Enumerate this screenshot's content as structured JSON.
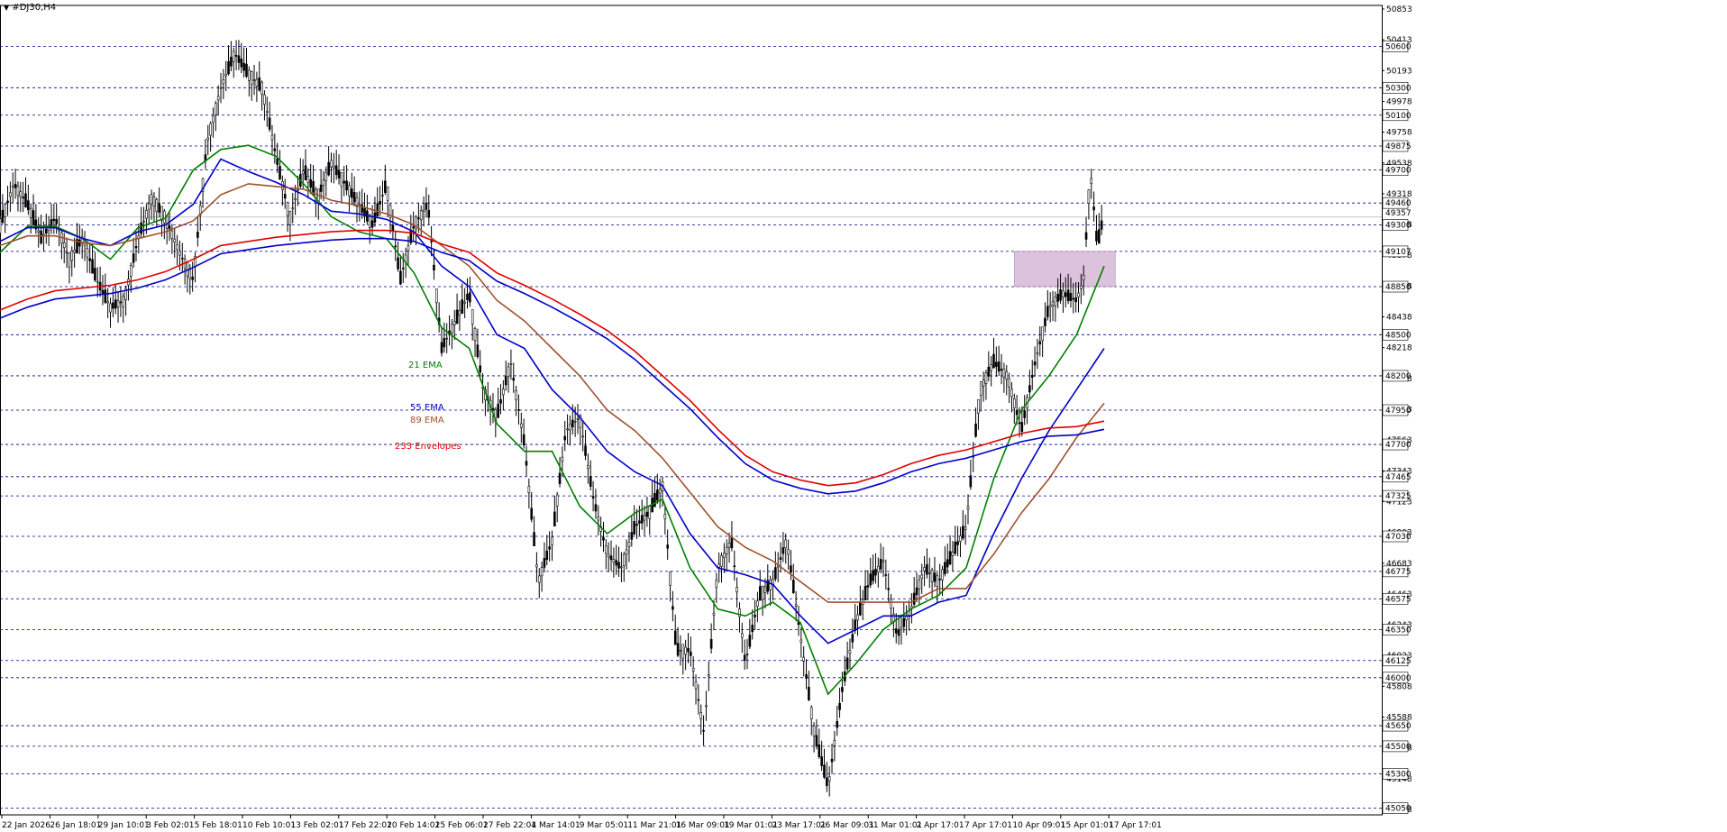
{
  "header": {
    "symbol_label": "#DJ30,H4",
    "menu_icon": "triangle-down-icon"
  },
  "chart_data": {
    "type": "line",
    "title": "#DJ30,H4",
    "xlabel": "",
    "ylabel": "",
    "ylim": [
      45000,
      50900
    ],
    "grid": "horizontal dashed",
    "x_ticks": [
      "22 Jan 2026",
      "26 Jan 18:01",
      "29 Jan 10:01",
      "3 Feb 02:01",
      "5 Feb 18:01",
      "10 Feb 10:01",
      "13 Feb 02:01",
      "17 Feb 22:01",
      "20 Feb 14:01",
      "25 Feb 06:01",
      "27 Feb 22:01",
      "4 Mar 14:01",
      "9 Mar 05:01",
      "11 Mar 21:01",
      "16 Mar 09:01",
      "19 Mar 01:01",
      "23 Mar 17:01",
      "26 Mar 09:01",
      "31 Mar 01:01",
      "2 Apr 17:01",
      "7 Apr 17:01",
      "10 Apr 09:01",
      "15 Apr 01:01",
      "17 Apr 17:01"
    ],
    "y_ticks": [
      "50853",
      "50413",
      "50193",
      "49978",
      "49758",
      "49538",
      "49318",
      "49098",
      "48878",
      "48658",
      "48438",
      "48218",
      "47998",
      "47783",
      "47563",
      "47343",
      "47123",
      "46903",
      "46683",
      "46463",
      "46243",
      "46023",
      "45808",
      "45588",
      "45368",
      "45148",
      "44928"
    ],
    "levels": [
      50600,
      50300,
      50100,
      49875,
      49700,
      49460,
      49300,
      49107,
      48850,
      48500,
      48200,
      47950,
      47700,
      47465,
      47325,
      47030,
      46775,
      46575,
      46350,
      46125,
      46000,
      45650,
      45500,
      45300,
      45050
    ],
    "current_price": "49357",
    "zone": {
      "y_from": 48850,
      "y_to": 49107,
      "x_from": 0.735,
      "x_to": 0.808
    },
    "series": [
      {
        "name": "21 EMA",
        "color": "#008000",
        "x": [
          0,
          0.02,
          0.04,
          0.06,
          0.08,
          0.1,
          0.12,
          0.14,
          0.16,
          0.18,
          0.2,
          0.22,
          0.24,
          0.26,
          0.28,
          0.3,
          0.32,
          0.34,
          0.36,
          0.38,
          0.4,
          0.42,
          0.44,
          0.46,
          0.48,
          0.5,
          0.52,
          0.54,
          0.56,
          0.58,
          0.6,
          0.62,
          0.64,
          0.66,
          0.68,
          0.7,
          0.72,
          0.74,
          0.76,
          0.78,
          0.8
        ],
        "values": [
          49100,
          49290,
          49290,
          49200,
          49050,
          49280,
          49350,
          49700,
          49850,
          49880,
          49800,
          49600,
          49360,
          49250,
          49200,
          48950,
          48550,
          48400,
          47850,
          47650,
          47650,
          47250,
          47050,
          47200,
          47300,
          46800,
          46500,
          46450,
          46550,
          46400,
          45880,
          46100,
          46350,
          46500,
          46600,
          46800,
          47450,
          47950,
          48200,
          48500,
          49000
        ]
      },
      {
        "name": "55 EMA",
        "color": "#0000c8",
        "x": [
          0,
          0.02,
          0.04,
          0.06,
          0.08,
          0.1,
          0.12,
          0.14,
          0.16,
          0.18,
          0.2,
          0.22,
          0.24,
          0.26,
          0.28,
          0.3,
          0.32,
          0.34,
          0.36,
          0.38,
          0.4,
          0.42,
          0.44,
          0.46,
          0.48,
          0.5,
          0.52,
          0.54,
          0.56,
          0.58,
          0.6,
          0.62,
          0.64,
          0.66,
          0.68,
          0.7,
          0.72,
          0.74,
          0.76,
          0.78,
          0.8
        ],
        "values": [
          49180,
          49280,
          49280,
          49200,
          49150,
          49250,
          49300,
          49450,
          49780,
          49690,
          49610,
          49520,
          49400,
          49380,
          49340,
          49250,
          49000,
          48850,
          48500,
          48400,
          48100,
          47900,
          47650,
          47500,
          47400,
          47050,
          46800,
          46750,
          46680,
          46450,
          46250,
          46350,
          46450,
          46450,
          46550,
          46600,
          47050,
          47450,
          47800,
          48100,
          48400
        ]
      },
      {
        "name": "89 EMA",
        "color": "#a0522d",
        "x": [
          0,
          0.02,
          0.04,
          0.06,
          0.08,
          0.1,
          0.12,
          0.14,
          0.16,
          0.18,
          0.2,
          0.22,
          0.24,
          0.26,
          0.28,
          0.3,
          0.32,
          0.34,
          0.36,
          0.38,
          0.4,
          0.42,
          0.44,
          0.46,
          0.48,
          0.5,
          0.52,
          0.54,
          0.56,
          0.58,
          0.6,
          0.62,
          0.64,
          0.66,
          0.68,
          0.7,
          0.72,
          0.74,
          0.76,
          0.78,
          0.8
        ],
        "values": [
          49150,
          49220,
          49220,
          49170,
          49150,
          49200,
          49250,
          49330,
          49520,
          49600,
          49580,
          49560,
          49480,
          49440,
          49380,
          49300,
          49150,
          49000,
          48750,
          48600,
          48400,
          48200,
          47950,
          47800,
          47600,
          47350,
          47100,
          46950,
          46850,
          46700,
          46550,
          46550,
          46550,
          46550,
          46650,
          46650,
          46900,
          47200,
          47450,
          47750,
          48000
        ]
      },
      {
        "name": "233 Envelopes",
        "color": "#e00000",
        "x": [
          0,
          0.02,
          0.04,
          0.06,
          0.08,
          0.1,
          0.12,
          0.14,
          0.16,
          0.18,
          0.2,
          0.22,
          0.24,
          0.26,
          0.28,
          0.3,
          0.32,
          0.34,
          0.36,
          0.38,
          0.4,
          0.42,
          0.44,
          0.46,
          0.48,
          0.5,
          0.52,
          0.54,
          0.56,
          0.58,
          0.6,
          0.62,
          0.64,
          0.66,
          0.68,
          0.7,
          0.72,
          0.74,
          0.76,
          0.78,
          0.8
        ],
        "values": [
          48680,
          48760,
          48820,
          48840,
          48860,
          48900,
          48960,
          49050,
          49150,
          49180,
          49210,
          49230,
          49250,
          49260,
          49260,
          49240,
          49160,
          49100,
          48950,
          48860,
          48760,
          48650,
          48530,
          48380,
          48200,
          48020,
          47810,
          47620,
          47500,
          47440,
          47400,
          47420,
          47480,
          47560,
          47620,
          47660,
          47720,
          47780,
          47820,
          47830,
          47870
        ]
      },
      {
        "name": "233 Envelopes lower",
        "color": "#0000c8",
        "x": [
          0,
          0.02,
          0.04,
          0.06,
          0.08,
          0.1,
          0.12,
          0.14,
          0.16,
          0.18,
          0.2,
          0.22,
          0.24,
          0.26,
          0.28,
          0.3,
          0.32,
          0.34,
          0.36,
          0.38,
          0.4,
          0.42,
          0.44,
          0.46,
          0.48,
          0.5,
          0.52,
          0.54,
          0.56,
          0.58,
          0.6,
          0.62,
          0.64,
          0.66,
          0.68,
          0.7,
          0.72,
          0.74,
          0.76,
          0.78,
          0.8
        ],
        "values": [
          48620,
          48700,
          48760,
          48780,
          48800,
          48840,
          48900,
          48990,
          49090,
          49120,
          49150,
          49170,
          49190,
          49200,
          49200,
          49180,
          49100,
          49040,
          48890,
          48800,
          48700,
          48590,
          48470,
          48320,
          48140,
          47960,
          47750,
          47560,
          47440,
          47380,
          47340,
          47360,
          47420,
          47500,
          47560,
          47600,
          47660,
          47720,
          47760,
          47770,
          47810
        ]
      }
    ],
    "price_path": {
      "x": [
        0,
        0.01,
        0.02,
        0.03,
        0.04,
        0.05,
        0.06,
        0.07,
        0.08,
        0.09,
        0.1,
        0.11,
        0.12,
        0.13,
        0.14,
        0.15,
        0.16,
        0.17,
        0.18,
        0.19,
        0.2,
        0.21,
        0.22,
        0.23,
        0.24,
        0.25,
        0.26,
        0.27,
        0.28,
        0.29,
        0.3,
        0.31,
        0.32,
        0.33,
        0.34,
        0.35,
        0.36,
        0.37,
        0.38,
        0.39,
        0.4,
        0.41,
        0.42,
        0.43,
        0.44,
        0.45,
        0.46,
        0.47,
        0.48,
        0.49,
        0.5,
        0.51,
        0.52,
        0.53,
        0.54,
        0.55,
        0.56,
        0.57,
        0.58,
        0.59,
        0.6,
        0.61,
        0.62,
        0.63,
        0.64,
        0.65,
        0.66,
        0.67,
        0.68,
        0.69,
        0.7,
        0.71,
        0.72,
        0.73,
        0.74,
        0.75,
        0.76,
        0.77,
        0.78,
        0.785,
        0.79,
        0.795,
        0.8
      ],
      "values": [
        49300,
        49600,
        49450,
        49200,
        49350,
        49050,
        49200,
        48900,
        48700,
        48750,
        49200,
        49500,
        49350,
        49100,
        48900,
        49900,
        50300,
        50550,
        50400,
        50300,
        49800,
        49350,
        49700,
        49500,
        49750,
        49600,
        49450,
        49300,
        49600,
        48900,
        49300,
        49450,
        48400,
        48600,
        48800,
        48100,
        47900,
        48300,
        47700,
        46700,
        47000,
        47800,
        47900,
        47300,
        46900,
        46800,
        47100,
        47200,
        47400,
        46200,
        46200,
        45600,
        46800,
        47000,
        46100,
        46600,
        46700,
        47000,
        46300,
        45600,
        45200,
        45900,
        46400,
        46700,
        46850,
        46300,
        46500,
        46800,
        46700,
        46900,
        47100,
        48100,
        48300,
        48200,
        47800,
        48300,
        48700,
        48800,
        48750,
        48900,
        49700,
        49150,
        49380
      ]
    },
    "annotations": [
      {
        "text": "21 EMA",
        "color": "#008000"
      },
      {
        "text": "55 EMA",
        "color": "#0000c8"
      },
      {
        "text": "89 EMA",
        "color": "#a0522d"
      },
      {
        "text": "233 Envelopes",
        "color": "#e00000"
      }
    ]
  },
  "colors": {
    "grid": "#00008b",
    "level_box": "#ffffff",
    "candle": "#000000",
    "zone_fill": "#d8b8d8"
  }
}
